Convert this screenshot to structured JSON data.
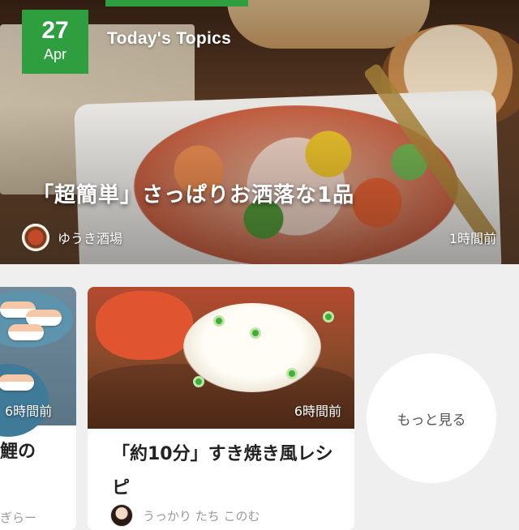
{
  "hero": {
    "date_day": "27",
    "date_month": "Apr",
    "section_title": "Today's Topics",
    "headline": "「超簡単」さっぱりお洒落な1品",
    "author": "ゆうき酒場",
    "time": "1時間前"
  },
  "cards": [
    {
      "time": "6時間前",
      "title": "鯉の",
      "author": "ぎらー"
    },
    {
      "time": "6時間前",
      "title": "「約10分」すき焼き風レシピ",
      "author": "うっかり たち このむ"
    }
  ],
  "more": {
    "label": "もっと見る"
  },
  "colors": {
    "accent_green": "#2e9e3f"
  }
}
